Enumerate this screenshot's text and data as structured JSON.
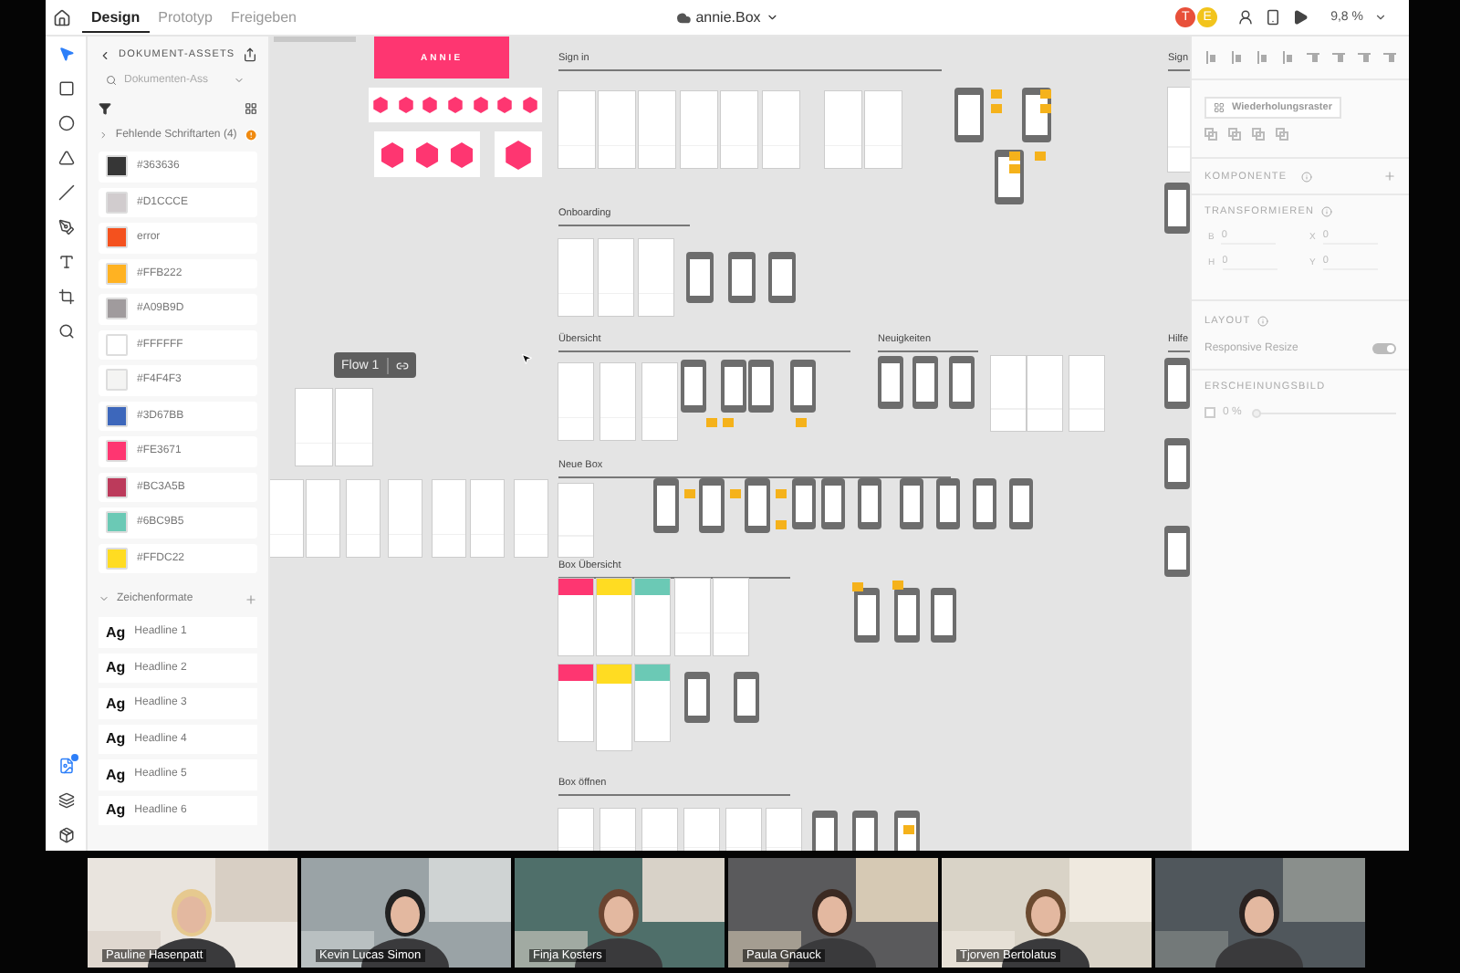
{
  "app": {
    "tabs": [
      {
        "label": "Design",
        "selected": true
      },
      {
        "label": "Prototyp",
        "selected": false
      },
      {
        "label": "Freigeben",
        "selected": false
      }
    ],
    "document_title": "annie.Box",
    "collaborators": [
      {
        "initial": "T",
        "color": "#e8503a"
      },
      {
        "initial": "E",
        "color": "#f2c41c"
      }
    ],
    "zoom": "9,8 %"
  },
  "assets": {
    "title": "DOKUMENT-ASSETS",
    "search": {
      "placeholder": "Dokumenten-Ass"
    },
    "missing_fonts": "Fehlende Schriftarten (4)",
    "colors": [
      {
        "label": "#363636",
        "color": "#363636"
      },
      {
        "label": "#D1CCCE",
        "color": "#d1ccce"
      },
      {
        "label": "error",
        "color": "#f4511e"
      },
      {
        "label": "#FFB222",
        "color": "#ffb222"
      },
      {
        "label": "#A09B9D",
        "color": "#a09b9d"
      },
      {
        "label": "#FFFFFF",
        "color": "#ffffff"
      },
      {
        "label": "#F4F4F3",
        "color": "#f4f4f3"
      },
      {
        "label": "#3D67BB",
        "color": "#3d67bb"
      },
      {
        "label": "#FE3671",
        "color": "#fe3671"
      },
      {
        "label": "#BC3A5B",
        "color": "#bc3a5b"
      },
      {
        "label": "#6BC9B5",
        "color": "#6bc9b5"
      },
      {
        "label": "#FFDC22",
        "color": "#ffdc22"
      }
    ],
    "char_styles_title": "Zeichenformate",
    "char_styles": [
      {
        "sample": "Ag",
        "label": "Headline 1"
      },
      {
        "sample": "Ag",
        "label": "Headline 2"
      },
      {
        "sample": "Ag",
        "label": "Headline 3"
      },
      {
        "sample": "Ag",
        "label": "Headline 4"
      },
      {
        "sample": "Ag",
        "label": "Headline 5"
      },
      {
        "sample": "Ag",
        "label": "Headline 6"
      }
    ]
  },
  "canvas": {
    "logo_text": "ANNIE",
    "flow": "Flow 1",
    "sections": [
      {
        "title": "Sign in"
      },
      {
        "title": "Onboarding"
      },
      {
        "title": "Übersicht"
      },
      {
        "title": "Neuigkeiten"
      },
      {
        "title": "Neue Box"
      },
      {
        "title": "Box Übersicht"
      },
      {
        "title": "Box öffnen"
      },
      {
        "title": "Sign"
      },
      {
        "title": "Hilfe"
      }
    ]
  },
  "properties": {
    "repeat_grid": "Wiederholungsraster",
    "component": "KOMPONENTE",
    "transform": "TRANSFORMIEREN",
    "fields": [
      {
        "label": "B",
        "value": "0"
      },
      {
        "label": "X",
        "value": "0"
      },
      {
        "label": "H",
        "value": "0"
      },
      {
        "label": "Y",
        "value": "0"
      }
    ],
    "layout": "LAYOUT",
    "responsive": {
      "label": "Responsive Resize",
      "on": true
    },
    "appearance": "ERSCHEINUNGSBILD",
    "opacity": {
      "checked": false,
      "value": "0 %",
      "level": 0
    }
  },
  "participants": [
    {
      "kind": "video",
      "name": "Pauline Hasenpatt"
    },
    {
      "kind": "video",
      "name": "Kevin Lucas Simon"
    },
    {
      "kind": "video",
      "name": "Finja Kosters"
    },
    {
      "kind": "video",
      "name": "Paula Gnauck"
    },
    {
      "kind": "video",
      "name": "Tjorven Bertolatus"
    },
    {
      "kind": "video"
    }
  ]
}
